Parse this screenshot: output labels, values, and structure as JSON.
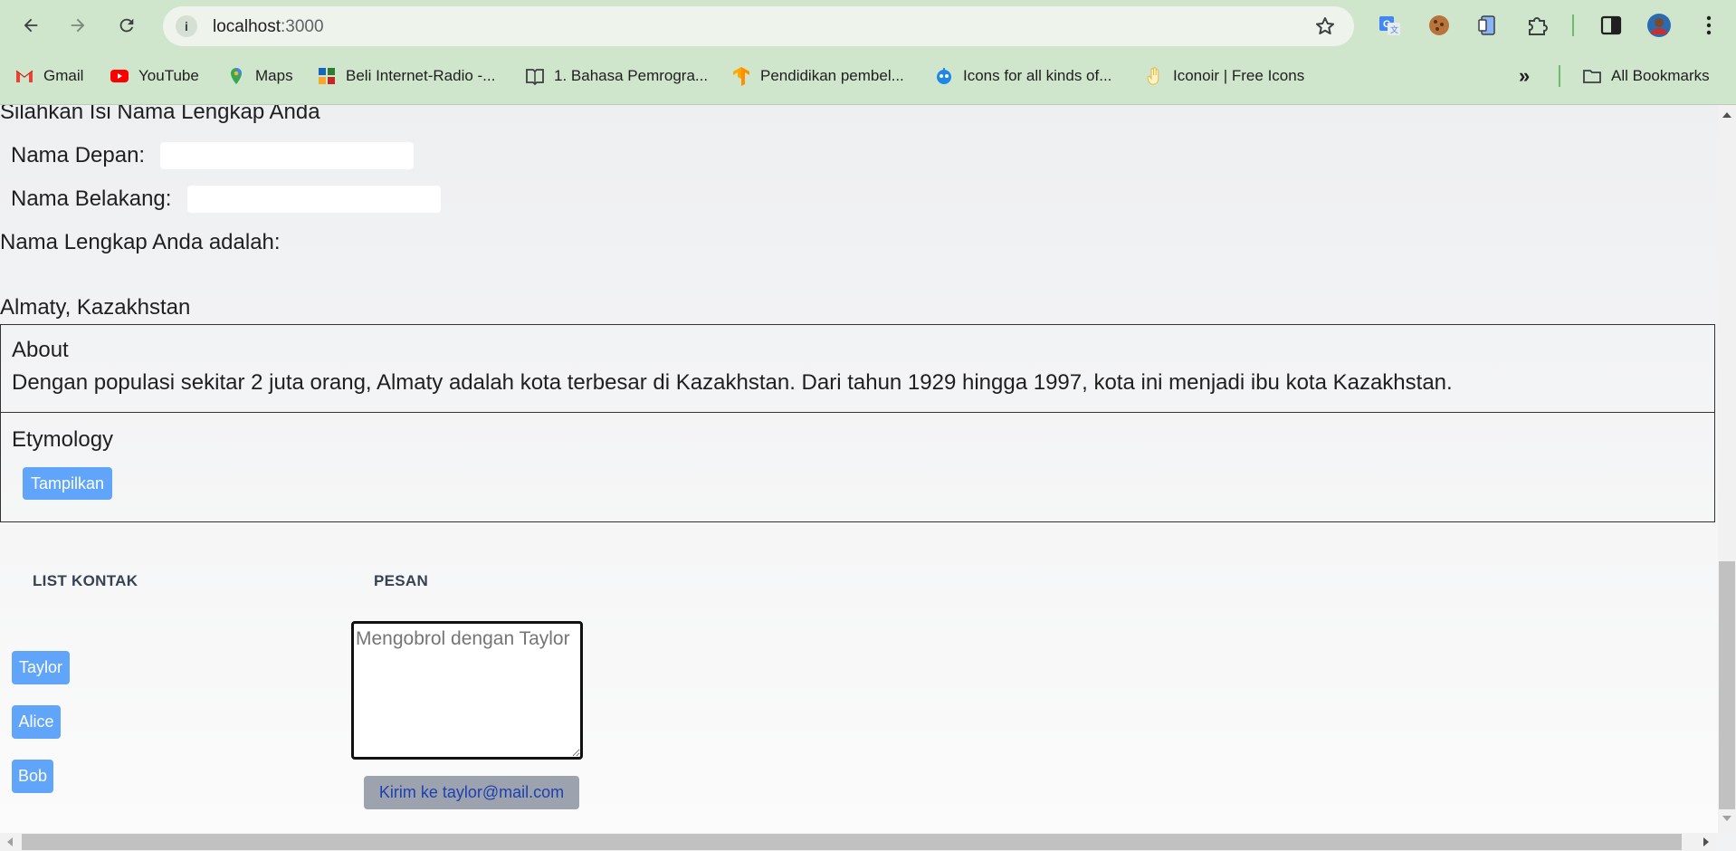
{
  "browser": {
    "url_host": "localhost",
    "url_port": ":3000",
    "bookmarks": [
      {
        "label": "Gmail",
        "icon": "gmail-icon"
      },
      {
        "label": "YouTube",
        "icon": "youtube-icon"
      },
      {
        "label": "Maps",
        "icon": "maps-icon"
      },
      {
        "label": "Beli Internet-Radio -...",
        "icon": "radio-icon"
      },
      {
        "label": "1. Bahasa Pemrogra...",
        "icon": "book-icon"
      },
      {
        "label": "Pendidikan pembel...",
        "icon": "tensorflow-icon"
      },
      {
        "label": "Icons for all kinds of...",
        "icon": "robot-icon"
      },
      {
        "label": "Iconoir | Free Icons",
        "icon": "hand-icon"
      }
    ],
    "all_bookmarks": "All Bookmarks"
  },
  "name_form": {
    "heading": "Silahkan Isi Nama Lengkap Anda",
    "first_name_label": "Nama Depan:",
    "first_name_value": "",
    "last_name_label": "Nama Belakang:",
    "last_name_value": "",
    "full_name_label": "Nama Lengkap Anda adalah:"
  },
  "city": {
    "title": "Almaty, Kazakhstan",
    "about_heading": "About",
    "about_text": "Dengan populasi sekitar 2 juta orang, Almaty adalah kota terbesar di Kazakhstan. Dari tahun 1929 hingga 1997, kota ini menjadi ibu kota Kazakhstan.",
    "etymology_heading": "Etymology",
    "show_button": "Tampilkan"
  },
  "chat": {
    "contacts_heading": "LIST KONTAK",
    "message_heading": "PESAN",
    "contacts": [
      "Taylor",
      "Alice",
      "Bob"
    ],
    "message_placeholder": "Mengobrol dengan Taylor",
    "message_value": "",
    "send_button": "Kirim ke taylor@mail.com"
  },
  "colors": {
    "chrome_bg": "#cfe6cc",
    "accent_blue": "#60a5fa",
    "send_button_bg": "#9ca3af"
  }
}
